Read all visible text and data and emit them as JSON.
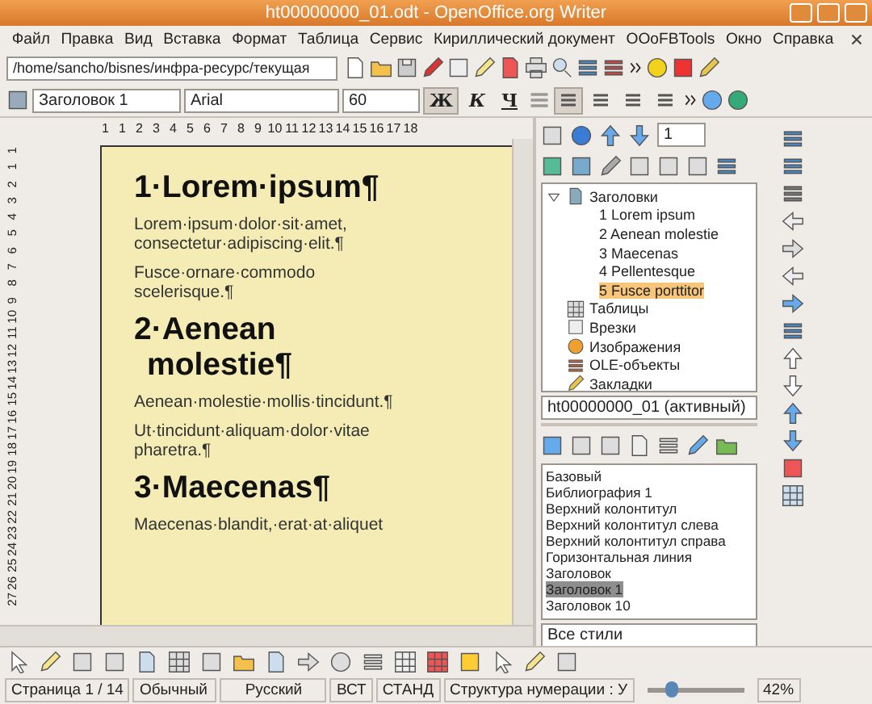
{
  "window": {
    "title": "ht00000000_01.odt - OpenOffice.org Writer"
  },
  "menu": [
    "Файл",
    "Правка",
    "Вид",
    "Вставка",
    "Формат",
    "Таблица",
    "Сервис",
    "Кириллический документ",
    "OOoFBTools",
    "Окно",
    "Справка"
  ],
  "standard_toolbar": {
    "path_field": "/home/sancho/bisnes/инфра-ресурс/текущая"
  },
  "formatting_toolbar": {
    "paragraph_style": "Заголовок 1",
    "font": "Arial",
    "size": "60",
    "style_buttons": [
      {
        "label": "Ж",
        "selected": true
      },
      {
        "label": "К",
        "selected": false
      },
      {
        "label": "Ч",
        "selected": false
      }
    ],
    "alignment": [
      {
        "selected": true
      },
      {
        "selected": false
      },
      {
        "selected": false
      },
      {
        "selected": false
      }
    ]
  },
  "ruler": {
    "labels": [
      "1",
      "1",
      "2",
      "3",
      "4",
      "5",
      "6",
      "7",
      "8",
      "9",
      "10",
      "11",
      "12",
      "13",
      "14",
      "15",
      "16",
      "17",
      "18"
    ]
  },
  "vertical_ruler": {
    "labels": [
      "1",
      "1",
      "2",
      "3",
      "4",
      "5",
      "6",
      "7",
      "8",
      "9",
      "10",
      "11",
      "12",
      "13",
      "14",
      "15",
      "16",
      "17",
      "18",
      "19",
      "20",
      "21",
      "22",
      "23",
      "24",
      "25",
      "26",
      "27"
    ]
  },
  "document": {
    "paragraphs": [
      {
        "kind": "heading",
        "text": "1·Lorem·ipsum¶"
      },
      {
        "kind": "body",
        "text": "Lorem·ipsum·dolor·sit·amet, consectetur·adipiscing·elit.¶"
      },
      {
        "kind": "body",
        "text": "Fusce·ornare·commodo scelerisque.¶"
      },
      {
        "kind": "heading",
        "text": "2·Aenean molestie¶"
      },
      {
        "kind": "body",
        "text": "Aenean·molestie·mollis·tincidunt.¶"
      },
      {
        "kind": "body",
        "text": "Ut·tincidunt·aliquam·dolor·vitae pharetra.¶"
      },
      {
        "kind": "heading",
        "text": "3·Maecenas¶"
      },
      {
        "kind": "body",
        "text": "Maecenas·blandit,·erat·at·aliquet"
      }
    ]
  },
  "navigator": {
    "page_number": "1",
    "tree": [
      {
        "label": "Заголовки",
        "kind": "headings",
        "expanded": true,
        "children": [
          {
            "label": "1 Lorem ipsum",
            "selected": false
          },
          {
            "label": "2 Aenean molestie",
            "selected": false
          },
          {
            "label": "3 Maecenas",
            "selected": false
          },
          {
            "label": "4 Pellentesque",
            "selected": false
          },
          {
            "label": "5 Fusce porttitor",
            "selected": true
          }
        ]
      },
      {
        "label": "Таблицы",
        "kind": "tables"
      },
      {
        "label": "Врезки",
        "kind": "frames"
      },
      {
        "label": "Изображения",
        "kind": "images"
      },
      {
        "label": "OLE-объекты",
        "kind": "ole"
      },
      {
        "label": "Закладки",
        "kind": "bookmarks"
      }
    ],
    "document_select": "ht00000000_01 (активный)"
  },
  "styles": {
    "items": [
      {
        "label": "Базовый",
        "selected": false
      },
      {
        "label": "Библиография 1",
        "selected": false
      },
      {
        "label": "Верхний колонтитул",
        "selected": false
      },
      {
        "label": "Верхний колонтитул слева",
        "selected": false
      },
      {
        "label": "Верхний колонтитул справа",
        "selected": false
      },
      {
        "label": "Горизонтальная линия",
        "selected": false
      },
      {
        "label": "Заголовок",
        "selected": false
      },
      {
        "label": "Заголовок 1",
        "selected": true
      },
      {
        "label": "Заголовок 10",
        "selected": false
      }
    ],
    "filter": "Все стили"
  },
  "status_bar": {
    "page": "Страница  1 / 14",
    "page_style": "Обычный",
    "language": "Русский",
    "insert_mode": "ВСТ",
    "selection_mode": "СТАНД",
    "outline": "Структура нумерации : У",
    "zoom_slider": {
      "level": 0.25
    },
    "zoom": "42%"
  }
}
